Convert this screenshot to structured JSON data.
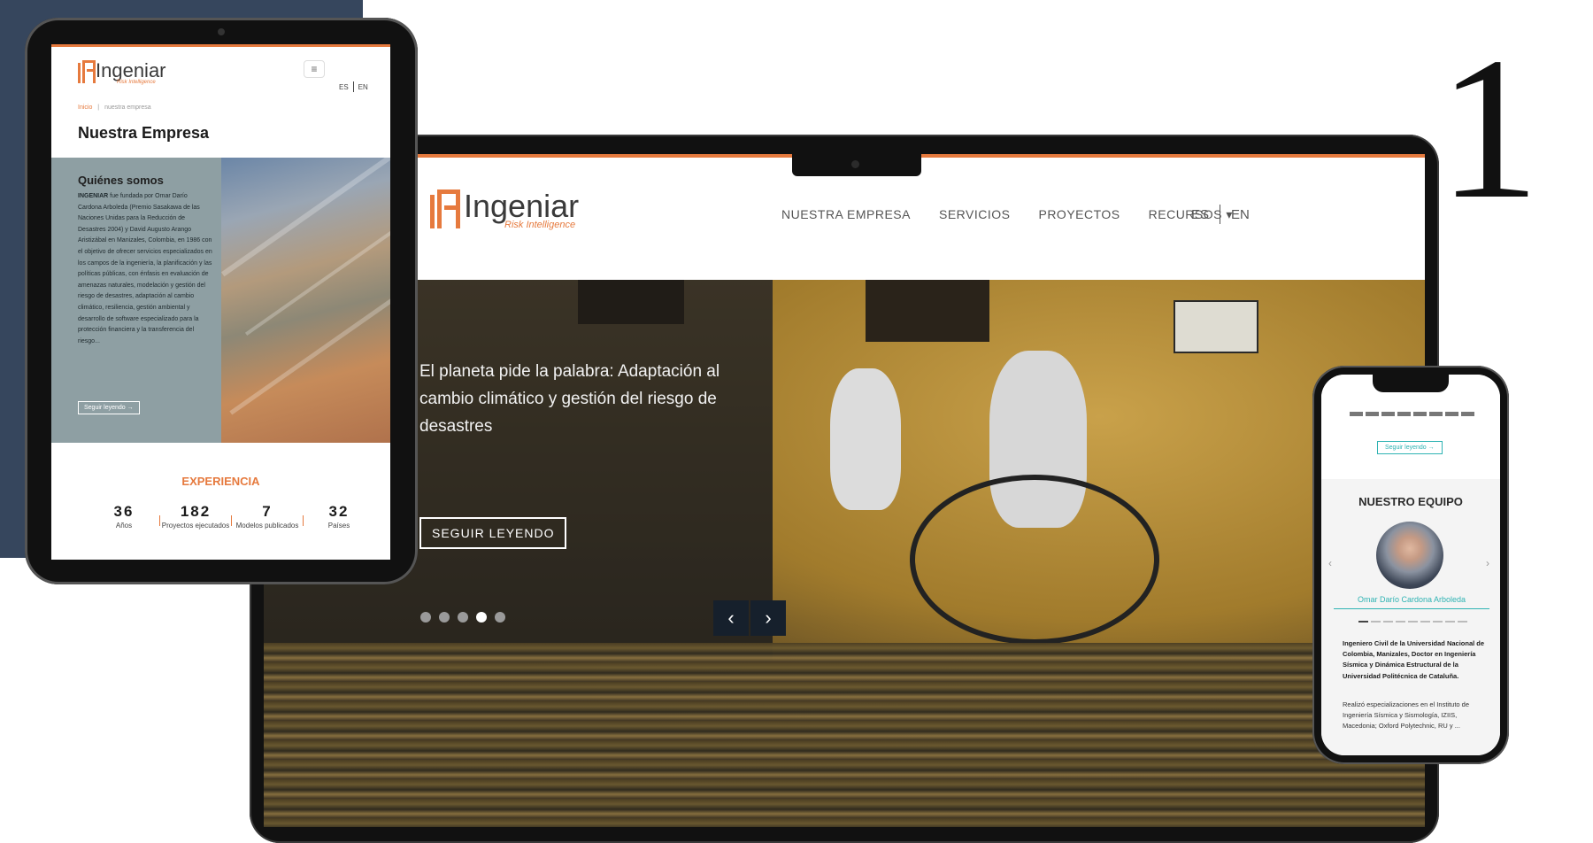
{
  "decor": {
    "number": "1"
  },
  "laptop": {
    "logo": {
      "name": "Ingeniar",
      "tagline": "Risk Intelligence"
    },
    "nav": [
      {
        "label": "NUESTRA EMPRESA"
      },
      {
        "label": "SERVICIOS"
      },
      {
        "label": "PROYECTOS"
      },
      {
        "label": "RECURSOS ▾"
      }
    ],
    "lang": {
      "es": "ES",
      "en": "EN"
    },
    "hero": {
      "title": "El planeta pide la palabra: Adaptación al cambio climático y gestión del riesgo de desastres",
      "button": "SEGUIR LEYENDO",
      "slides_total": 5,
      "active_slide": 4,
      "prev_icon": "‹",
      "next_icon": "›"
    }
  },
  "tablet": {
    "logo": {
      "name": "Ingeniar",
      "tagline": "Risk Intelligence"
    },
    "menu_icon": "≡",
    "lang": {
      "es": "ES",
      "en": "EN"
    },
    "breadcrumb": {
      "home": "Inicio",
      "sep": "|",
      "current": "nuestra empresa"
    },
    "title": "Nuestra Empresa",
    "about": {
      "heading": "Quiénes somos",
      "brand": "INGENIAR",
      "text": " fue fundada por Omar Darío Cardona Arboleda (Premio Sasakawa de las Naciones Unidas para la Reducción de Desastres 2004) y David Augusto Arango Aristizábal en Manizales, Colombia, en 1986 con el objetivo de ofrecer servicios especializados en los campos de la ingeniería, la planificación y las políticas públicas, con énfasis en evaluación de amenazas naturales, modelación y gestión del riesgo de desastres, adaptación al cambio climático, resiliencia, gestión ambiental y desarrollo de software especializado para la protección financiera y la transferencia del riesgo...",
      "button": "Seguir leyendo"
    },
    "experience": {
      "heading": "EXPERIENCIA",
      "stats": [
        {
          "value": "36",
          "label": "Años"
        },
        {
          "value": "182",
          "label": "Proyectos ejecutados"
        },
        {
          "value": "7",
          "label": "Modelos publicados"
        },
        {
          "value": "32",
          "label": "Países"
        }
      ]
    }
  },
  "phone": {
    "button": "Seguir leyendo",
    "team_heading": "NUESTRO EQUIPO",
    "member_name": "Omar Darío Cardona Arboleda",
    "bio_bold": "Ingeniero Civil de la Universidad Nacional de Colombia, Manizales, Doctor en Ingeniería Sísmica y Dinámica Estructural de la Universidad Politécnica de Cataluña.",
    "bio_text": "Realizó especializaciones en el Instituto de Ingeniería Sísmica y Sismología, IZIIS, Macedonia; Oxford Polytechnic, RU y ...",
    "prev_icon": "‹",
    "next_icon": "›",
    "pager_total": 9,
    "pager_active": 1
  },
  "colors": {
    "accent": "#e67a3e",
    "teal": "#2fb3b3",
    "navy": "#36465d"
  }
}
